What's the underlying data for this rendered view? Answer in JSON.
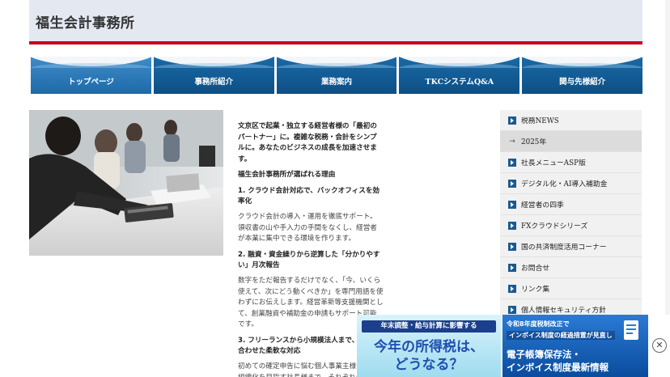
{
  "header": {
    "title": "福生会計事務所"
  },
  "nav": {
    "items": [
      {
        "label": "トップページ"
      },
      {
        "label": "事務所紹介"
      },
      {
        "label": "業務案内"
      },
      {
        "label": "TKCシステムQ&A"
      },
      {
        "label": "関与先様紹介"
      }
    ]
  },
  "main": {
    "intro": "文京区で起業・独立する経営者様の「最初のパートナー」に。複雑な税務・会計をシンプルに。あなたのビジネスの成長を加速させます。",
    "heading": "福生会計事務所が選ばれる理由",
    "points": [
      {
        "title": "1. クラウド会計対応で、バックオフィスを効率化",
        "body": "クラウド会計の導入・運用を徹底サポート。領収書の山や手入力の手間をなくし、経営者が本業に集中できる環境を作ります。"
      },
      {
        "title": "2. 融資・資金繰りから逆算した「分かりやすい」月次報告",
        "body": "数字をただ報告するだけでなく、「今、いくら使えて、次にどう動くべきか」を専門用語を使わずにお伝えします。経営革新等支援機関として、創業融資や補助金の申請もサポート可能です。"
      },
      {
        "title": "3. フリーランスから小規模法人まで、成長に合わせた柔軟な対応",
        "body": "初めての確定申告に悩む個人事業主様から、組織化を目指す社長様まで、それぞれの"
      }
    ]
  },
  "sidebar": {
    "items": [
      {
        "label": "税務NEWS",
        "sub": false
      },
      {
        "label": "2025年",
        "sub": true
      },
      {
        "label": "社長メニューASP版",
        "sub": false
      },
      {
        "label": "デジタル化・AI導入補助金",
        "sub": false
      },
      {
        "label": "経営者の四季",
        "sub": false
      },
      {
        "label": "FXクラウドシリーズ",
        "sub": false
      },
      {
        "label": "国の共済制度活用コーナー",
        "sub": false
      },
      {
        "label": "お問合せ",
        "sub": false
      },
      {
        "label": "リンク集",
        "sub": false
      },
      {
        "label": "個人情報セキュリティ方針",
        "sub": false
      }
    ]
  },
  "banners": {
    "left": {
      "line1": "年末調整・給与計算に影響する",
      "line2": "今年の所得税は、",
      "line3": "どうなる？"
    },
    "right": {
      "line1": "令和8年度税制改正で",
      "line2": "インボイス制度の経過措置が見直し",
      "line3": "電子帳簿保存法・",
      "line4": "インボイス制度最新情報"
    }
  },
  "colors": {
    "accent_red": "#c8001a",
    "nav_blue": "#0d4f86",
    "sidebar_bullet": "#1b5a90"
  }
}
